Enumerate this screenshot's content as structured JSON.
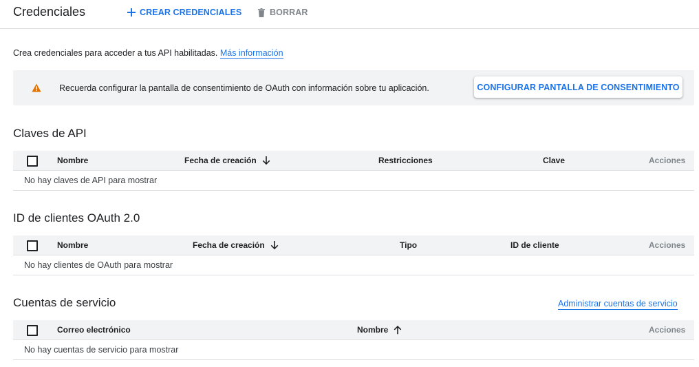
{
  "header": {
    "title": "Credenciales",
    "create_label": "CREAR CREDENCIALES",
    "delete_label": "BORRAR"
  },
  "intro": {
    "text": "Crea credenciales para acceder a tus API habilitadas.",
    "link": "Más información"
  },
  "banner": {
    "message": "Recuerda configurar la pantalla de consentimiento de OAuth con información sobre tu aplicación.",
    "button": "CONFIGURAR PANTALLA DE CONSENTIMIENTO"
  },
  "api_keys": {
    "title": "Claves de API",
    "columns": [
      "Nombre",
      "Fecha de creación",
      "Restricciones",
      "Clave",
      "Acciones"
    ],
    "empty": "No hay claves de API para mostrar"
  },
  "oauth": {
    "title": "ID de clientes OAuth 2.0",
    "columns": [
      "Nombre",
      "Fecha de creación",
      "Tipo",
      "ID de cliente",
      "Acciones"
    ],
    "empty": "No hay clientes de OAuth para mostrar"
  },
  "service_accounts": {
    "title": "Cuentas de servicio",
    "manage_link": "Administrar cuentas de servicio",
    "columns": [
      "Correo electrónico",
      "Nombre",
      "Acciones"
    ],
    "empty": "No hay cuentas de servicio para mostrar"
  },
  "icons": {
    "create": "plus-icon",
    "delete": "trash-icon",
    "warning": "warning-icon",
    "sort_desc": "arrow-down-icon",
    "sort_asc": "arrow-up-icon"
  },
  "colors": {
    "accent": "#1a73e8",
    "warning": "#e37400",
    "muted": "#80868b",
    "header_bg": "#f1f3f4"
  }
}
